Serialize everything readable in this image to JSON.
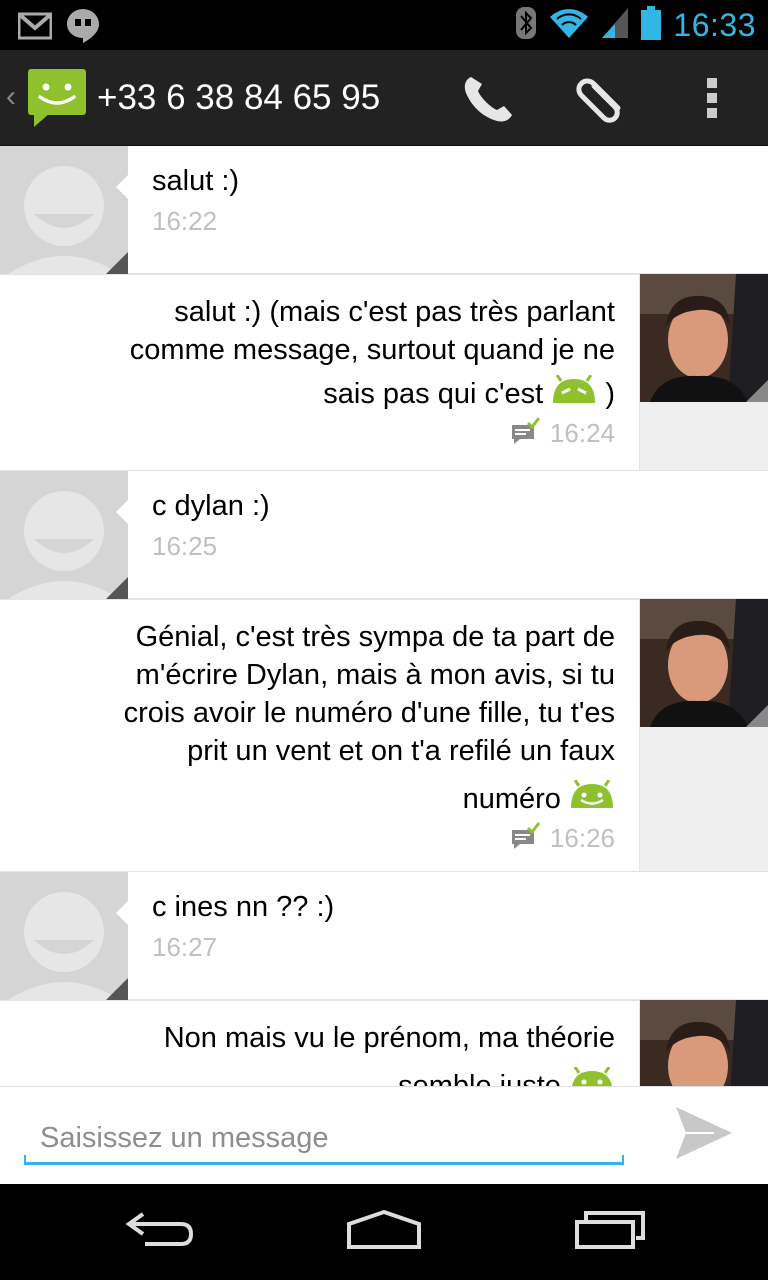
{
  "status_bar": {
    "time": "16:33",
    "icons": [
      "gmail-icon",
      "hangouts-icon",
      "bluetooth-icon",
      "wifi-icon",
      "signal-icon",
      "battery-icon"
    ]
  },
  "action_bar": {
    "back_glyph": "‹",
    "contact": "+33 6 38 84 65 95",
    "icons": [
      "messaging-app-icon",
      "phone-icon",
      "attach-icon",
      "overflow-menu-icon"
    ]
  },
  "messages": [
    {
      "direction": "incoming",
      "text": "salut :)",
      "time": "16:22"
    },
    {
      "direction": "outgoing",
      "text_lines": [
        "salut :) (mais c'est pas très parlant",
        "comme message, surtout quand je ne"
      ],
      "text_end": "sais pas qui c'est",
      "text_end_suffix": ")",
      "time": "16:24"
    },
    {
      "direction": "incoming",
      "text": "c dylan :)",
      "time": "16:25"
    },
    {
      "direction": "outgoing",
      "text_lines": [
        "Génial, c'est très sympa de ta part de",
        "m'écrire Dylan, mais à mon avis, si tu",
        "crois avoir le numéro d'une fille, tu t'es",
        "prit un vent et on t'a refilé un faux"
      ],
      "text_end": "numéro",
      "time": "16:26"
    },
    {
      "direction": "incoming",
      "text": "c ines nn ?? :)",
      "time": "16:27"
    },
    {
      "direction": "outgoing",
      "text_lines": [
        "Non mais vu le prénom, ma théorie"
      ],
      "text_end": "semble juste"
    }
  ],
  "compose": {
    "placeholder": "Saisissez un message"
  },
  "colors": {
    "accent": "#33b5e5",
    "android_green": "#8fc12f",
    "action_bar": "#222222"
  }
}
